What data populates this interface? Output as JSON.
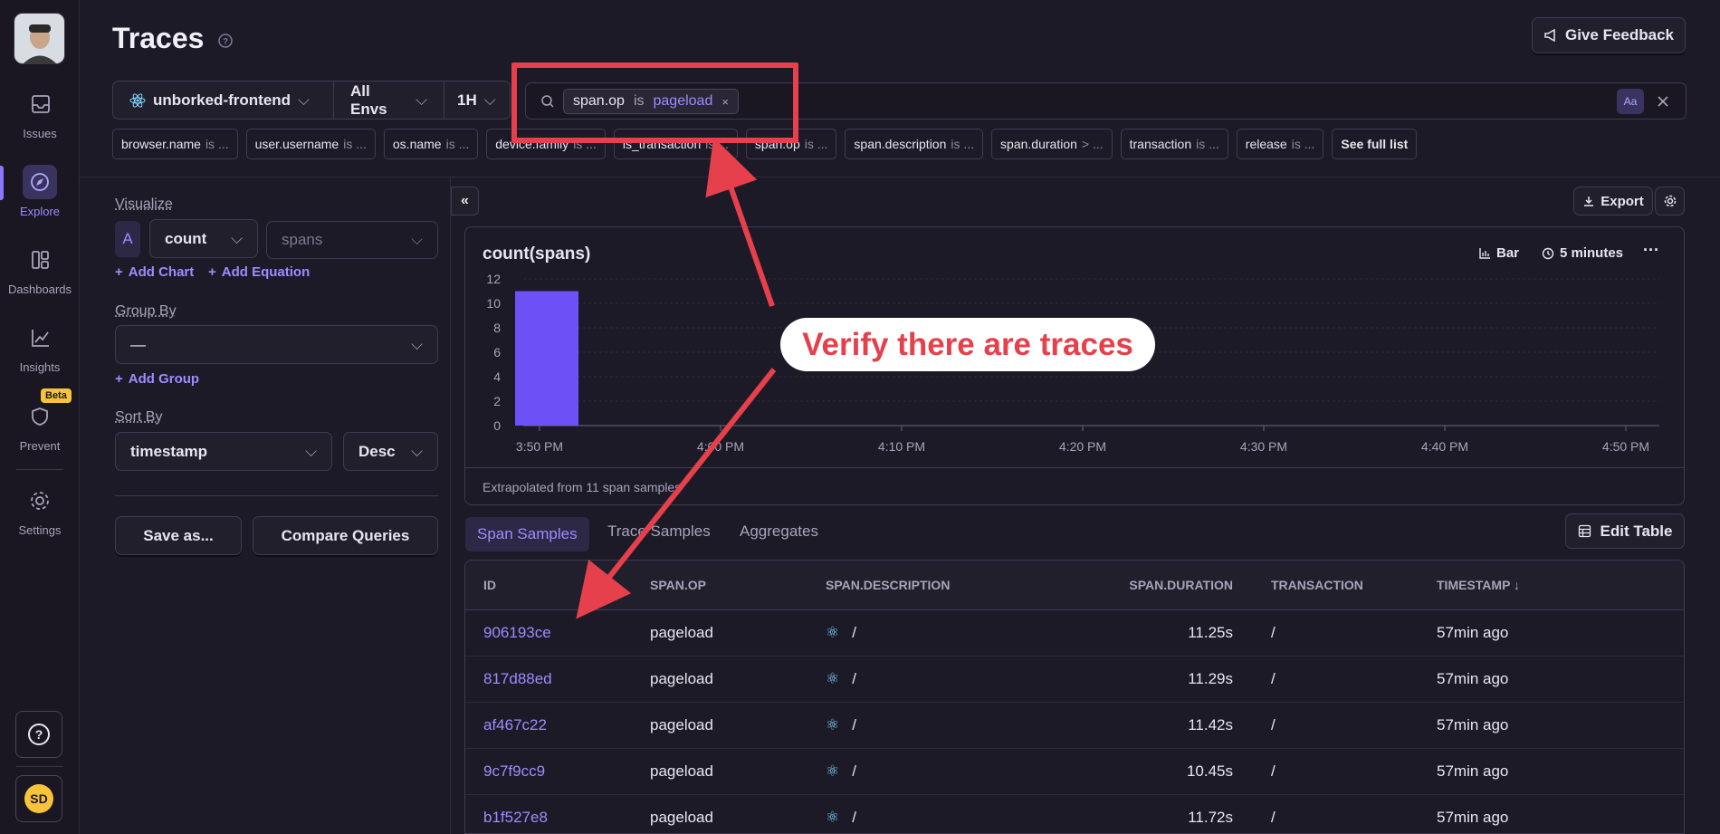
{
  "sidebar": {
    "items": [
      {
        "label": "Issues",
        "icon": "inbox-icon"
      },
      {
        "label": "Explore",
        "icon": "compass-icon",
        "active": true
      },
      {
        "label": "Dashboards",
        "icon": "dashboard-icon"
      },
      {
        "label": "Insights",
        "icon": "chart-line-icon"
      },
      {
        "label": "Prevent",
        "icon": "shield-icon",
        "badge": "Beta"
      },
      {
        "label": "Settings",
        "icon": "gear-icon"
      }
    ],
    "user_initials": "SD"
  },
  "header": {
    "title": "Traces",
    "feedback_label": "Give Feedback",
    "project": "unborked-frontend",
    "env": "All Envs",
    "period": "1H",
    "search_token": {
      "key": "span.op",
      "op": "is",
      "value": "pageload"
    },
    "case_toggle": "Aa"
  },
  "filter_chips": [
    {
      "key": "browser.name",
      "op": "is ..."
    },
    {
      "key": "user.username",
      "op": "is ..."
    },
    {
      "key": "os.name",
      "op": "is ..."
    },
    {
      "key": "device.family",
      "op": "is ..."
    },
    {
      "key": "is_transaction",
      "op": "is ..."
    },
    {
      "key": "span.op",
      "op": "is ..."
    },
    {
      "key": "span.description",
      "op": "is ..."
    },
    {
      "key": "span.duration",
      "op": "> ..."
    },
    {
      "key": "transaction",
      "op": "is ..."
    },
    {
      "key": "release",
      "op": "is ..."
    },
    {
      "key": "See full list",
      "op": ""
    }
  ],
  "left_panel": {
    "visualize_label": "Visualize",
    "series_letter": "A",
    "aggregate": "count",
    "field": "spans",
    "add_chart": "Add Chart",
    "add_equation": "Add Equation",
    "group_by_label": "Group By",
    "group_by_value": "—",
    "add_group": "Add Group",
    "sort_by_label": "Sort By",
    "sort_field": "timestamp",
    "sort_dir": "Desc",
    "save_as": "Save as...",
    "compare": "Compare Queries"
  },
  "toolbar": {
    "export": "Export"
  },
  "chart_data": {
    "type": "bar",
    "title": "count(spans)",
    "display_type": "Bar",
    "interval": "5 minutes",
    "categories": [
      "3:50 PM"
    ],
    "values": [
      11
    ],
    "x_ticks": [
      "3:50 PM",
      "4:00 PM",
      "4:10 PM",
      "4:20 PM",
      "4:30 PM",
      "4:40 PM",
      "4:50 PM"
    ],
    "y_ticks": [
      0,
      2,
      4,
      6,
      8,
      10,
      12
    ],
    "ylim": [
      0,
      12
    ],
    "bar_color": "#6e50f7",
    "footer": "Extrapolated from 11 span samples"
  },
  "tabs": [
    "Span Samples",
    "Trace Samples",
    "Aggregates"
  ],
  "edit_table": "Edit Table",
  "table": {
    "columns": [
      "ID",
      "SPAN.OP",
      "SPAN.DESCRIPTION",
      "SPAN.DURATION",
      "TRANSACTION",
      "TIMESTAMP ↓"
    ],
    "rows": [
      {
        "id": "906193ce",
        "op": "pageload",
        "desc": "/",
        "dur": "11.25s",
        "tx": "/",
        "ts": "57min ago"
      },
      {
        "id": "817d88ed",
        "op": "pageload",
        "desc": "/",
        "dur": "11.29s",
        "tx": "/",
        "ts": "57min ago"
      },
      {
        "id": "af467c22",
        "op": "pageload",
        "desc": "/",
        "dur": "11.42s",
        "tx": "/",
        "ts": "57min ago"
      },
      {
        "id": "9c7f9cc9",
        "op": "pageload",
        "desc": "/",
        "dur": "10.45s",
        "tx": "/",
        "ts": "57min ago"
      },
      {
        "id": "b1f527e8",
        "op": "pageload",
        "desc": "/",
        "dur": "11.72s",
        "tx": "/",
        "ts": "57min ago"
      }
    ]
  },
  "annotation": {
    "callout": "Verify there are traces",
    "color": "#e5404b"
  }
}
